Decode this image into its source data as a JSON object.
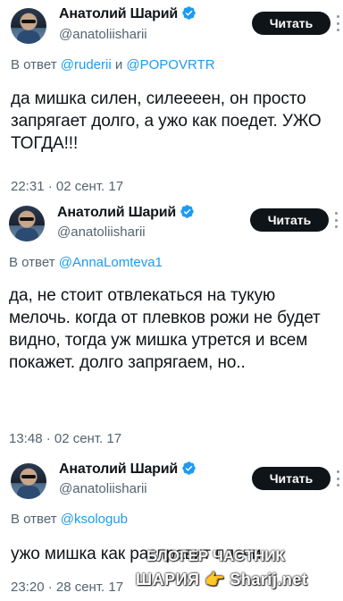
{
  "tweets": [
    {
      "author_name": "Анатолий Шарий",
      "author_handle": "@anatoliisharii",
      "follow_label": "Читать",
      "reply_prefix": "В ответ",
      "reply_to_1": "@ruderii",
      "reply_joiner": "и",
      "reply_to_2": "@POPOVRTR",
      "body": "да мишка силен, силеееен, он просто запрягает долго, а ужо как поедет. УЖО ТОГДА!!!",
      "timestamp": "22:31 · 02 сент. 17"
    },
    {
      "author_name": "Анатолий Шарий",
      "author_handle": "@anatoliisharii",
      "follow_label": "Читать",
      "reply_prefix": "В ответ",
      "reply_to_1": "@AnnaLomteva1",
      "body": "да, не стоит отвлекаться на тукую мелочь. когда от плевков рожи не будет видно, тогда уж мишка утрется и всем покажет. долго запрягаем, но..",
      "timestamp": "13:48 · 02 сент. 17"
    },
    {
      "author_name": "Анатолий Шарий",
      "author_handle": "@anatoliisharii",
      "follow_label": "Читать",
      "reply_prefix": "В ответ",
      "reply_to_1": "@ksologub",
      "body": "ужо мишка как расправит плечи...",
      "timestamp": "23:20 · 28 сент. 17"
    }
  ],
  "watermark": {
    "line1": "БЛОГЕР ЧАСТНИК",
    "line2": "ШАРИЯ 👉 Sharij.net"
  },
  "colors": {
    "link": "#1d9bf0",
    "muted": "#536471",
    "verified": "#1d9bf0",
    "button_bg": "#0f1419"
  }
}
